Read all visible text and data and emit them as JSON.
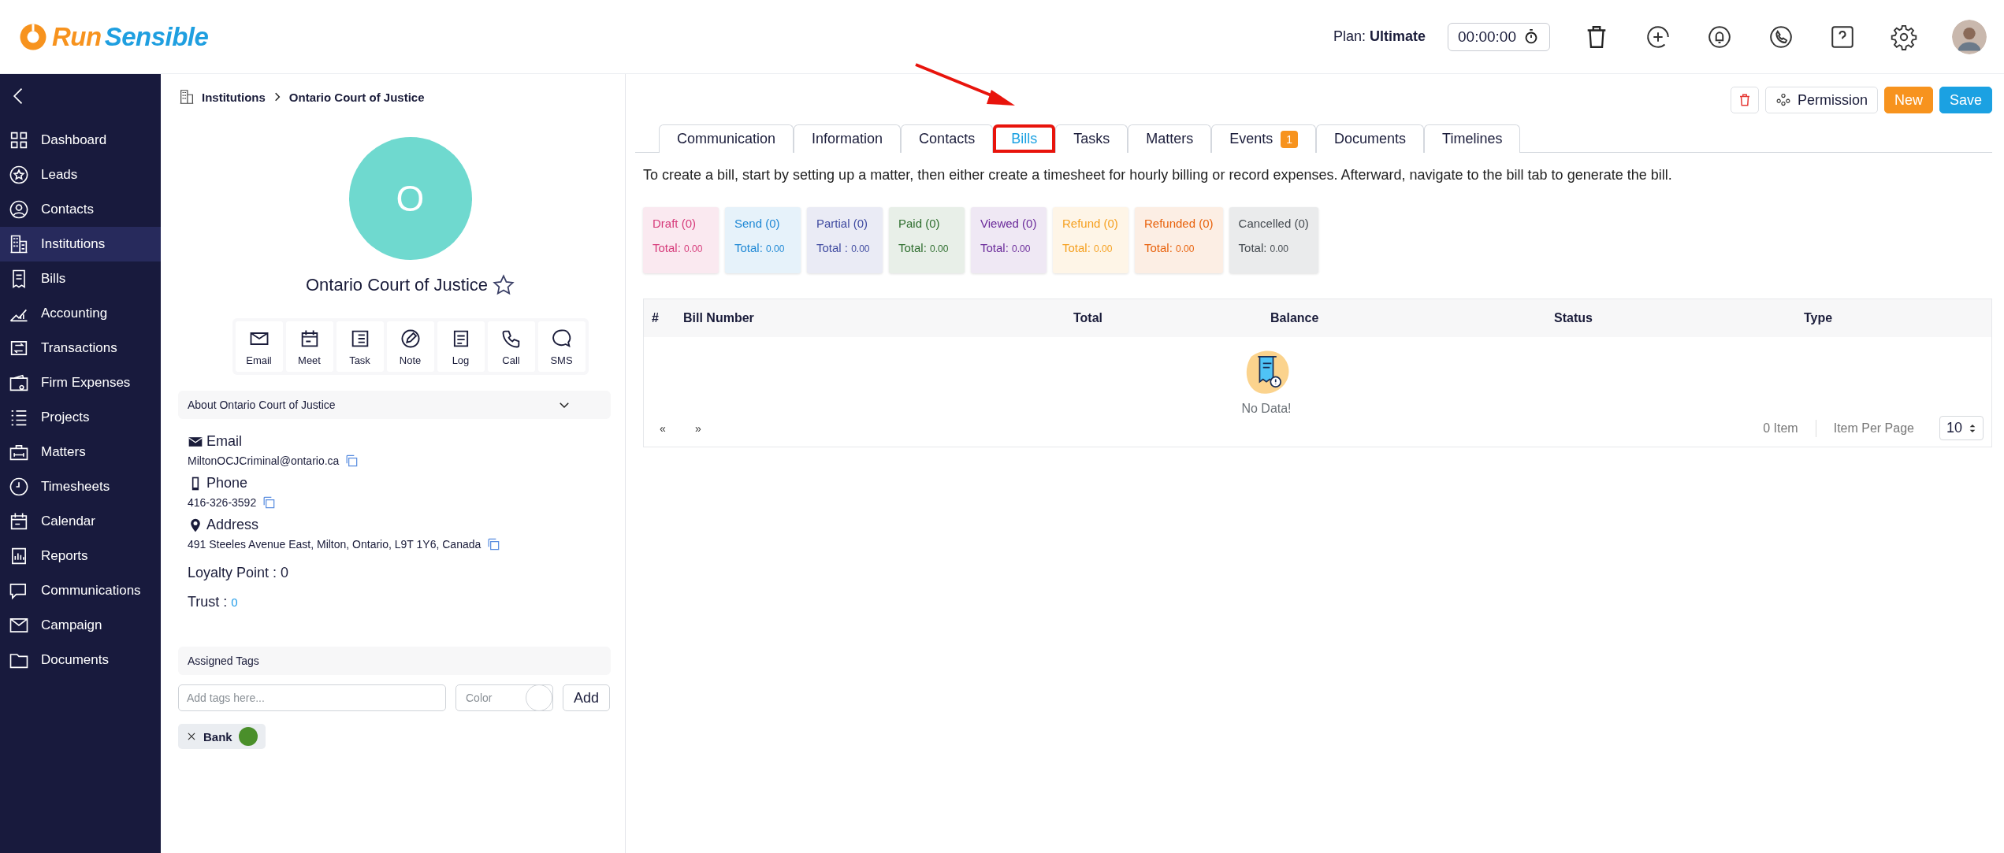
{
  "header": {
    "logo": {
      "first": "Run",
      "second": "Sensible"
    },
    "plan": "Plan: **Ultimate**",
    "timer": "00:00:00"
  },
  "sidebar": {
    "items": [
      {
        "label": "Dashboard",
        "selected": false
      },
      {
        "label": "Leads",
        "selected": false
      },
      {
        "label": "Contacts",
        "selected": false
      },
      {
        "label": "Institutions",
        "selected": true
      },
      {
        "label": "Bills",
        "selected": false
      },
      {
        "label": "Accounting",
        "selected": false
      },
      {
        "label": "Transactions",
        "selected": false
      },
      {
        "label": "Firm Expenses",
        "selected": false
      },
      {
        "label": "Projects",
        "selected": false
      },
      {
        "label": "Matters",
        "selected": false
      },
      {
        "label": "Timesheets",
        "selected": false
      },
      {
        "label": "Calendar",
        "selected": false
      },
      {
        "label": "Reports",
        "selected": false
      },
      {
        "label": "Communications",
        "selected": false
      },
      {
        "label": "Campaign",
        "selected": false
      },
      {
        "label": "Documents",
        "selected": false
      }
    ]
  },
  "breadcrumb": [
    "Institutions",
    "Ontario Court of Justice"
  ],
  "page_actions": {
    "permission": "Permission",
    "new": "New",
    "save": "Save"
  },
  "profile": {
    "initial": "O",
    "name": "Ontario Court of Justice",
    "favorite": false,
    "actions": [
      "Email",
      "Meet",
      "Task",
      "Note",
      "Log",
      "Call",
      "SMS"
    ],
    "about_title": "About Ontario Court of Justice",
    "email_label": "Email",
    "email": "MiltonOCJCriminal@ontario.ca",
    "phone_label": "Phone",
    "phone": "416-326-3592",
    "address_label": "Address",
    "address": "491 Steeles Avenue East, Milton, Ontario, L9T 1Y6, Canada",
    "loyalty": "Loyalty Point : 0",
    "trust_label": "Trust :",
    "trust": "0"
  },
  "tags": {
    "title": "Assigned Tags",
    "placeholder": "Add tags here...",
    "color_placeholder": "Color",
    "add": "Add",
    "items": [
      {
        "label": "Bank",
        "color": "#4a8f2a"
      }
    ]
  },
  "tabs": [
    {
      "label": "Communication",
      "selected": false,
      "highlighted": false
    },
    {
      "label": "Information",
      "selected": false,
      "highlighted": false
    },
    {
      "label": "Contacts",
      "selected": false,
      "highlighted": false
    },
    {
      "label": "Bills",
      "selected": true,
      "highlighted": true
    },
    {
      "label": "Tasks",
      "selected": false,
      "highlighted": false
    },
    {
      "label": "Matters",
      "selected": false,
      "highlighted": false
    },
    {
      "label": "Events",
      "selected": false,
      "highlighted": false,
      "badge": "1"
    },
    {
      "label": "Documents",
      "selected": false,
      "highlighted": false
    },
    {
      "label": "Timelines",
      "selected": false,
      "highlighted": false
    }
  ],
  "hint": "To create a bill, start by setting up a matter, then either create a timesheet for hourly billing or record expenses. Afterward, navigate to the bill tab to generate the bill.",
  "status_cards": [
    {
      "label": "Draft (0)",
      "total_label": "Total:",
      "total": "0.00",
      "color": "#d63a7a"
    },
    {
      "label": "Send (0)",
      "total_label": "Total:",
      "total": "0.00",
      "color": "#1e88d5"
    },
    {
      "label": "Partial (0)",
      "total_label": "Total :",
      "total": "0.00",
      "color": "#3f4aa0"
    },
    {
      "label": "Paid (0)",
      "total_label": "Total:",
      "total": "0.00",
      "color": "#2e6e2e"
    },
    {
      "label": "Viewed (0)",
      "total_label": "Total:",
      "total": "0.00",
      "color": "#6a2a9a"
    },
    {
      "label": "Refund (0)",
      "total_label": "Total:",
      "total": "0.00",
      "color": "#f5a020"
    },
    {
      "label": "Refunded (0)",
      "total_label": "Total:",
      "total": "0.00",
      "color": "#e8620c"
    },
    {
      "label": "Cancelled (0)",
      "total_label": "Total:",
      "total": "0.00",
      "color": "#444a50"
    }
  ],
  "table": {
    "columns": [
      "#",
      "Bill Number",
      "Total",
      "Balance",
      "Status",
      "Type"
    ],
    "empty": "No Data!",
    "pagination": {
      "prev": "«",
      "next": "»",
      "count": "0 Item",
      "per_page_label": "Item Per Page",
      "per_page": "10"
    }
  }
}
